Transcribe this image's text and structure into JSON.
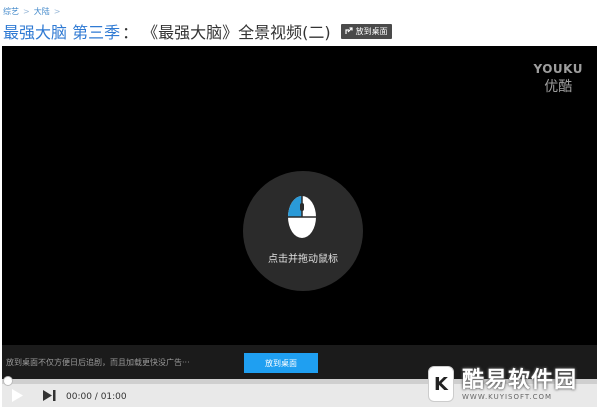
{
  "breadcrumb": {
    "items": [
      "综艺",
      "大陆"
    ],
    "separator": ">"
  },
  "title": {
    "show": "最强大脑 第三季",
    "colon": "：",
    "episode": "《最强大脑》全景视频(二)",
    "desktop_button": "放到桌面"
  },
  "player": {
    "watermark_top": "YOUKU",
    "watermark_bottom": "优酷",
    "hint_text": "点击并拖动鼠标",
    "promo_text": "放到桌面不仅方便日后追剧，而且加载更快没广告···",
    "promo_button": "放到桌面",
    "progress": 0.0,
    "time": "00:00 / 01:00"
  },
  "site_logo": {
    "brand": "酷易软件园",
    "url": "WWW.KUYISOFT.COM"
  },
  "colors": {
    "link_blue": "#2f7ad3",
    "accent_blue": "#1f9ff1",
    "player_bg": "#000000"
  },
  "icons": [
    "share-icon",
    "mouse-icon",
    "play-icon",
    "next-icon"
  ]
}
